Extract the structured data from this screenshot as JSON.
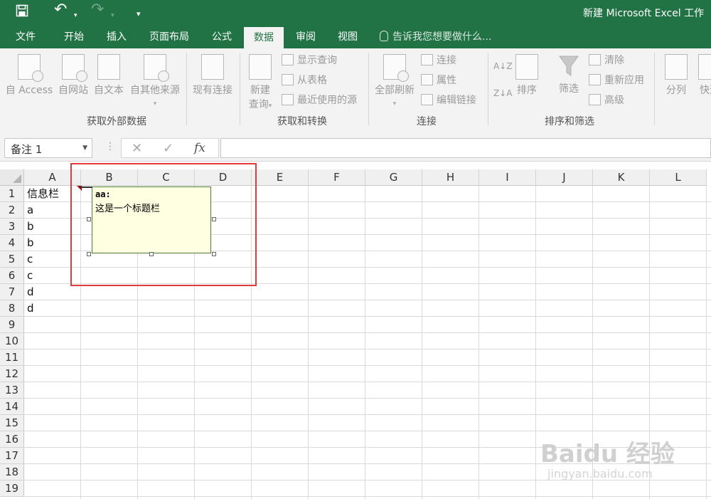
{
  "window": {
    "title": "新建 Microsoft Excel 工作",
    "quick_access": {
      "save": "save-icon",
      "undo": "↶",
      "redo": "↷",
      "customize": "▾"
    }
  },
  "tabs": [
    "文件",
    "开始",
    "插入",
    "页面布局",
    "公式",
    "数据",
    "审阅",
    "视图"
  ],
  "active_tab": "数据",
  "tell_me": "告诉我您想要做什么...",
  "ribbon": {
    "get_external": {
      "label": "获取外部数据",
      "buttons": [
        "自 Access",
        "自网站",
        "自文本",
        "自其他来源",
        "现有连接"
      ]
    },
    "get_transform": {
      "label": "获取和转换",
      "new_query_1": "新建",
      "new_query_2": "查询",
      "show_queries": "显示查询",
      "from_table": "从表格",
      "recent_sources": "最近使用的源"
    },
    "connections": {
      "label": "连接",
      "refresh_all": "全部刷新",
      "connections": "连接",
      "properties": "属性",
      "edit_links": "编辑链接"
    },
    "sort_filter": {
      "label": "排序和筛选",
      "sort_az": "A↓Z",
      "sort_za": "Z↓A",
      "sort": "排序",
      "filter": "筛选",
      "clear": "清除",
      "reapply": "重新应用",
      "advanced": "高级"
    },
    "data_tools": {
      "split": "分列",
      "quick": "快速"
    }
  },
  "formula_bar": {
    "name_box": "备注 1",
    "cancel": "✕",
    "enter": "✓",
    "fx": "fx",
    "value": ""
  },
  "sheet": {
    "columns": [
      "A",
      "B",
      "C",
      "D",
      "E",
      "F",
      "G",
      "H",
      "I",
      "J",
      "K",
      "L"
    ],
    "rows": [
      "1",
      "2",
      "3",
      "4",
      "5",
      "6",
      "7",
      "8",
      "9",
      "10",
      "11",
      "12",
      "13",
      "14",
      "15",
      "16",
      "17",
      "18",
      "19"
    ],
    "column_a": [
      "信息栏",
      "a",
      "b",
      "b",
      "c",
      "c",
      "d",
      "d"
    ]
  },
  "comment": {
    "author": "aa:",
    "text": "这是一个标题栏"
  },
  "watermark": {
    "main": "Baidu 经验",
    "sub": "jingyan.baidu.com"
  },
  "colors": {
    "excel_green": "#217346",
    "highlight_red": "#e03c3c",
    "comment_bg": "#ffffe1"
  }
}
